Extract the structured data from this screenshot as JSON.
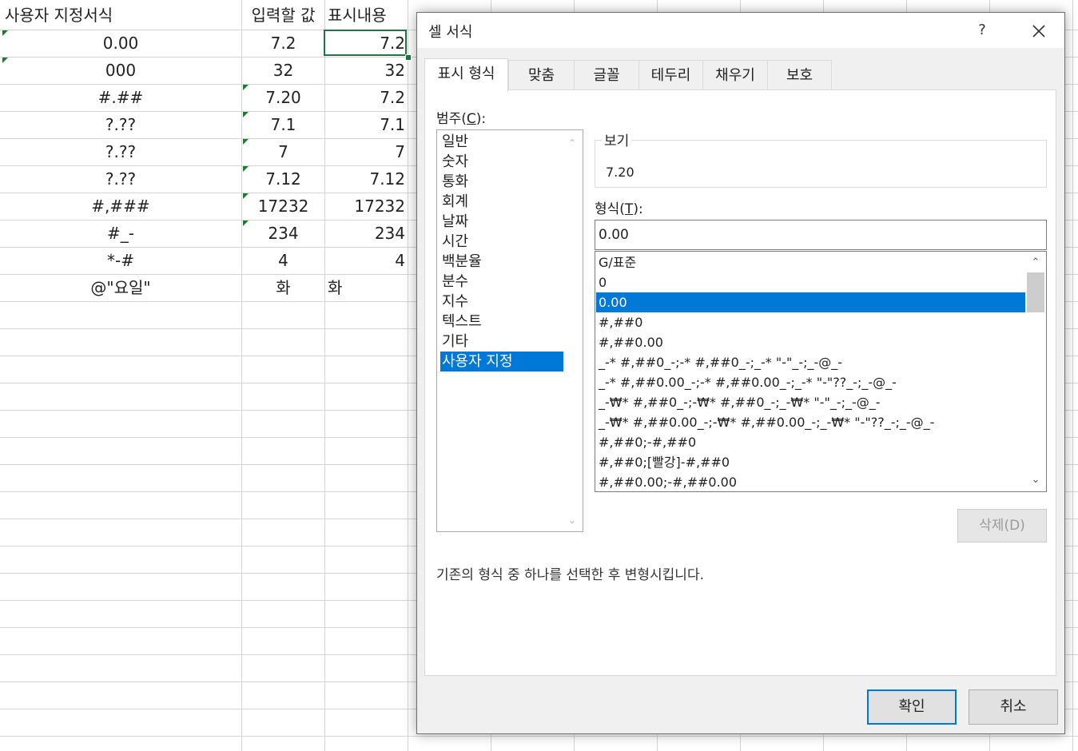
{
  "sheet": {
    "header": {
      "a": "사용자 지정서식",
      "b": "입력할 값",
      "c": "표시내용"
    },
    "rows": [
      {
        "a": "0.00",
        "b": "7.2",
        "c": "7.2"
      },
      {
        "a": "000",
        "b": "32",
        "c": "32"
      },
      {
        "a": "#.##",
        "b": "7.20",
        "c": "7.2"
      },
      {
        "a": "?.??",
        "b": "7.1",
        "c": "7.1"
      },
      {
        "a": "?.??",
        "b": "7",
        "c": "7"
      },
      {
        "a": "?.??",
        "b": "7.12",
        "c": "7.12"
      },
      {
        "a": "#,###",
        "b": "17232",
        "c": "17232"
      },
      {
        "a": "#_-",
        "b": "234",
        "c": "234"
      },
      {
        "a": "*-#",
        "b": "4",
        "c": "4"
      },
      {
        "a": "@\"요일\"",
        "b": "화",
        "c": "화"
      }
    ],
    "accent_color": "#217346"
  },
  "dialog": {
    "title": "셀 서식",
    "help": "?",
    "tabs": [
      "표시 형식",
      "맞춤",
      "글꼴",
      "테두리",
      "채우기",
      "보호"
    ],
    "category_label": "범주(",
    "category_mnemonic": "C",
    "category_label_end": "):",
    "categories": [
      "일반",
      "숫자",
      "통화",
      "회계",
      "날짜",
      "시간",
      "백분율",
      "분수",
      "지수",
      "텍스트",
      "기타",
      "사용자 지정"
    ],
    "selected_category_index": 11,
    "preview_label": "보기",
    "preview_value": "7.20",
    "format_label": "형식(",
    "format_mnemonic": "T",
    "format_label_end": "):",
    "format_value": "0.00",
    "formats": [
      "G/표준",
      "0",
      "0.00",
      "#,##0",
      "#,##0.00",
      "_-* #,##0_-;-* #,##0_-;_-* \"-\"_-;_-@_-",
      "_-* #,##0.00_-;-* #,##0.00_-;_-* \"-\"??_-;_-@_-",
      "_-₩* #,##0_-;-₩* #,##0_-;_-₩* \"-\"_-;_-@_-",
      "_-₩* #,##0.00_-;-₩* #,##0.00_-;_-₩* \"-\"??_-;_-@_-",
      "#,##0;-#,##0",
      "#,##0;[빨강]-#,##0",
      "#,##0.00;-#,##0.00"
    ],
    "selected_format_index": 2,
    "delete_button": "삭제(D)",
    "hint": "기존의 형식 중 하나를 선택한 후 변형시킵니다.",
    "ok_button": "확인",
    "cancel_button": "취소",
    "selection_color": "#0078d7"
  }
}
